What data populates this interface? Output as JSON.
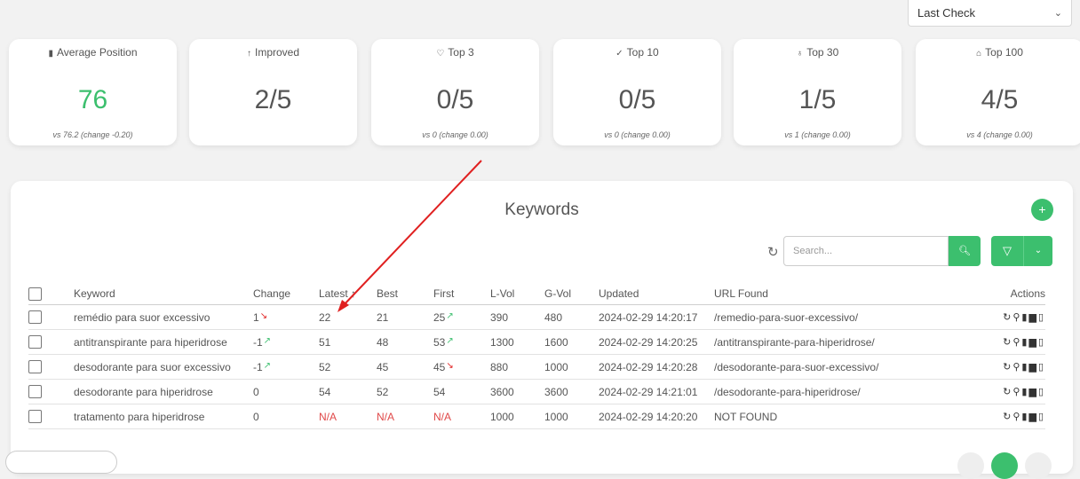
{
  "filter": {
    "selected": "Last Check"
  },
  "cards": [
    {
      "icon": "bar-chart-icon",
      "glyph": "▮",
      "title": "Average Position",
      "value": "76",
      "sub": "vs 76.2 (change -0.20)"
    },
    {
      "icon": "arrow-up-icon",
      "glyph": "↑",
      "title": "Improved",
      "value": "2/5",
      "sub": ""
    },
    {
      "icon": "heart-icon",
      "glyph": "♡",
      "title": "Top 3",
      "value": "0/5",
      "sub": "vs 0 (change 0.00)"
    },
    {
      "icon": "check-icon",
      "glyph": "✓",
      "title": "Top 10",
      "value": "0/5",
      "sub": "vs 0 (change 0.00)"
    },
    {
      "icon": "award-icon",
      "glyph": "♁",
      "title": "Top 30",
      "value": "1/5",
      "sub": "vs 1 (change 0.00)"
    },
    {
      "icon": "building-icon",
      "glyph": "⌂",
      "title": "Top 100",
      "value": "4/5",
      "sub": "vs 4 (change 0.00)"
    }
  ],
  "panel": {
    "title": "Keywords",
    "search_placeholder": "Search..."
  },
  "table": {
    "headers": [
      "Keyword",
      "Change",
      "Latest",
      "Best",
      "First",
      "L-Vol",
      "G-Vol",
      "Updated",
      "URL Found",
      "Actions"
    ],
    "rows": [
      {
        "keyword": "remédio para suor excessivo",
        "change": "1",
        "change_trend": "down",
        "latest": "22",
        "best": "21",
        "first": "25",
        "first_trend": "up",
        "lvol": "390",
        "gvol": "480",
        "updated": "2024-02-29 14:20:17",
        "url": "/remedio-para-suor-excessivo/"
      },
      {
        "keyword": "antitranspirante para hiperidrose",
        "change": "-1",
        "change_trend": "up",
        "latest": "51",
        "best": "48",
        "first": "53",
        "first_trend": "up",
        "lvol": "1300",
        "gvol": "1600",
        "updated": "2024-02-29 14:20:25",
        "url": "/antitranspirante-para-hiperidrose/"
      },
      {
        "keyword": "desodorante para suor excessivo",
        "change": "-1",
        "change_trend": "up",
        "latest": "52",
        "best": "45",
        "first": "45",
        "first_trend": "down",
        "lvol": "880",
        "gvol": "1000",
        "updated": "2024-02-29 14:20:28",
        "url": "/desodorante-para-suor-excessivo/"
      },
      {
        "keyword": "desodorante para hiperidrose",
        "change": "0",
        "change_trend": "",
        "latest": "54",
        "best": "52",
        "first": "54",
        "first_trend": "",
        "lvol": "3600",
        "gvol": "3600",
        "updated": "2024-02-29 14:21:01",
        "url": "/desodorante-para-hiperidrose/"
      },
      {
        "keyword": "tratamento para hiperidrose",
        "change": "0",
        "change_trend": "",
        "latest": "N/A",
        "best": "N/A",
        "first": "N/A",
        "first_trend": "",
        "lvol": "1000",
        "gvol": "1000",
        "updated": "2024-02-29 14:20:20",
        "url": "NOT FOUND"
      }
    ]
  },
  "colors": {
    "accent": "#3cbf6e",
    "negative": "#e04848",
    "annotation_arrow": "#e02020"
  }
}
